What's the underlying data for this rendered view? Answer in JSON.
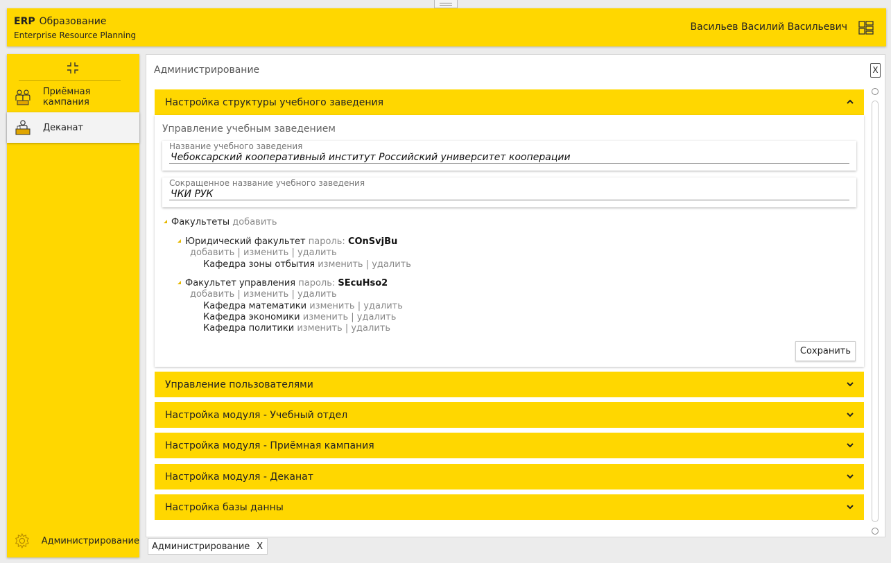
{
  "header": {
    "brand": "ERP",
    "product": "Образование",
    "subtitle": "Enterprise Resource Planning",
    "user": "Васильев Василий Васильевич"
  },
  "sidebar": {
    "items": [
      {
        "label": "Приёмная кампания",
        "icon": "people-icon"
      },
      {
        "label": "Деканат",
        "icon": "dean-office-icon",
        "active": true
      }
    ],
    "bottom": {
      "label": "Администрирование",
      "icon": "gear-icon"
    }
  },
  "main": {
    "title": "Администрирование",
    "close": "X",
    "sections": [
      "Настройка структуры учебного заведения",
      "Управление пользователями",
      "Настройка модуля - Учебный отдел",
      "Настройка модуля - Приёмная кампания",
      "Настройка модуля - Деканат",
      "Настройка базы данны"
    ],
    "structure": {
      "section_title": "Управление учебным заведением",
      "name_label": "Название учебного заведения",
      "name_value": "Чебоксарский кооперативный институт Российский университет кооперации",
      "short_label": "Сокращенное название учебного заведения",
      "short_value": "ЧКИ РУК",
      "faculties_label": "Факультеты",
      "add": "добавить",
      "edit": "изменить",
      "delete": "удалить",
      "sep": "|",
      "password_label": "пароль:",
      "faculties": [
        {
          "name": "Юридический факультет",
          "password": "COnSvjBu",
          "departments": [
            "Кафедра зоны отбытия"
          ]
        },
        {
          "name": "Факультет управления",
          "password": "SEcuHso2",
          "departments": [
            "Кафедра математики",
            "Кафедра экономики",
            "Кафедра политики"
          ]
        }
      ],
      "save": "Сохранить"
    }
  },
  "tabs": [
    {
      "label": "Администрирование",
      "close": "X"
    }
  ],
  "colors": {
    "accent": "#ffd700"
  }
}
